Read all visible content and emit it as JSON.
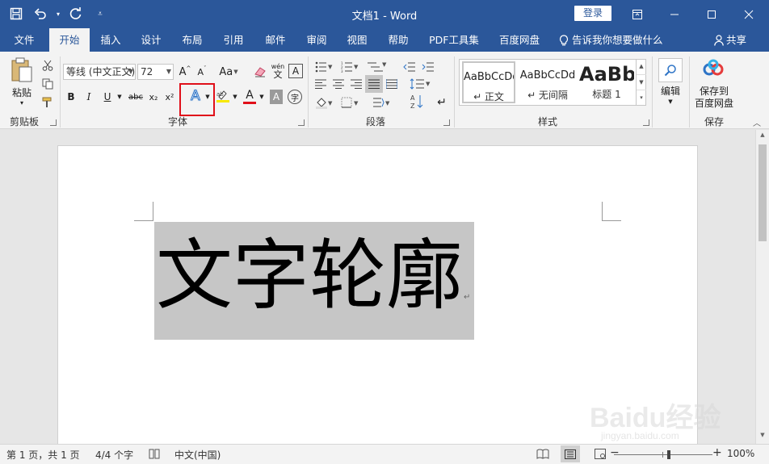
{
  "titlebar": {
    "title": "文档1  -  Word",
    "login": "登录"
  },
  "tabs": [
    {
      "label": "文件"
    },
    {
      "label": "开始"
    },
    {
      "label": "插入"
    },
    {
      "label": "设计"
    },
    {
      "label": "布局"
    },
    {
      "label": "引用"
    },
    {
      "label": "邮件"
    },
    {
      "label": "审阅"
    },
    {
      "label": "视图"
    },
    {
      "label": "帮助"
    },
    {
      "label": "PDF工具集"
    },
    {
      "label": "百度网盘"
    }
  ],
  "active_tab": "开始",
  "tell_me": "告诉我你想要做什么",
  "share": "共享",
  "ribbon": {
    "clipboard": {
      "paste": "粘贴",
      "group": "剪贴板"
    },
    "font": {
      "font_name": "等线 (中文正文)",
      "font_size": "72",
      "group": "字体",
      "phonetic": "wén",
      "aa": "Aa",
      "bold": "B",
      "italic": "I",
      "underline": "U",
      "strike": "abc",
      "sub": "x₂",
      "sup": "x²",
      "effects": "A",
      "font_color": "A",
      "shade": "A",
      "enclose": "字"
    },
    "paragraph": {
      "group": "段落"
    },
    "styles": {
      "group": "样式",
      "items": [
        {
          "preview": "AaBbCcDd",
          "label": "↵ 正文"
        },
        {
          "preview": "AaBbCcDd",
          "label": "↵ 无间隔"
        },
        {
          "preview": "AaBb",
          "label": "标题 1"
        }
      ]
    },
    "editing": {
      "label": "编辑"
    },
    "save": {
      "label_line1": "保存到",
      "label_line2": "百度网盘",
      "group": "保存"
    }
  },
  "document": {
    "text": "文字轮廓",
    "para_mark": "↵"
  },
  "statusbar": {
    "page": "第 1 页，共 1 页",
    "words": "4/4 个字",
    "lang": "中文(中国)",
    "zoom": "100%",
    "minus": "−",
    "plus": "+"
  },
  "watermark": {
    "logo": "Baidu经验",
    "url": "jingyan.baidu.com"
  },
  "colors": {
    "accent": "#2b579a",
    "highlight": "#e0101a"
  }
}
